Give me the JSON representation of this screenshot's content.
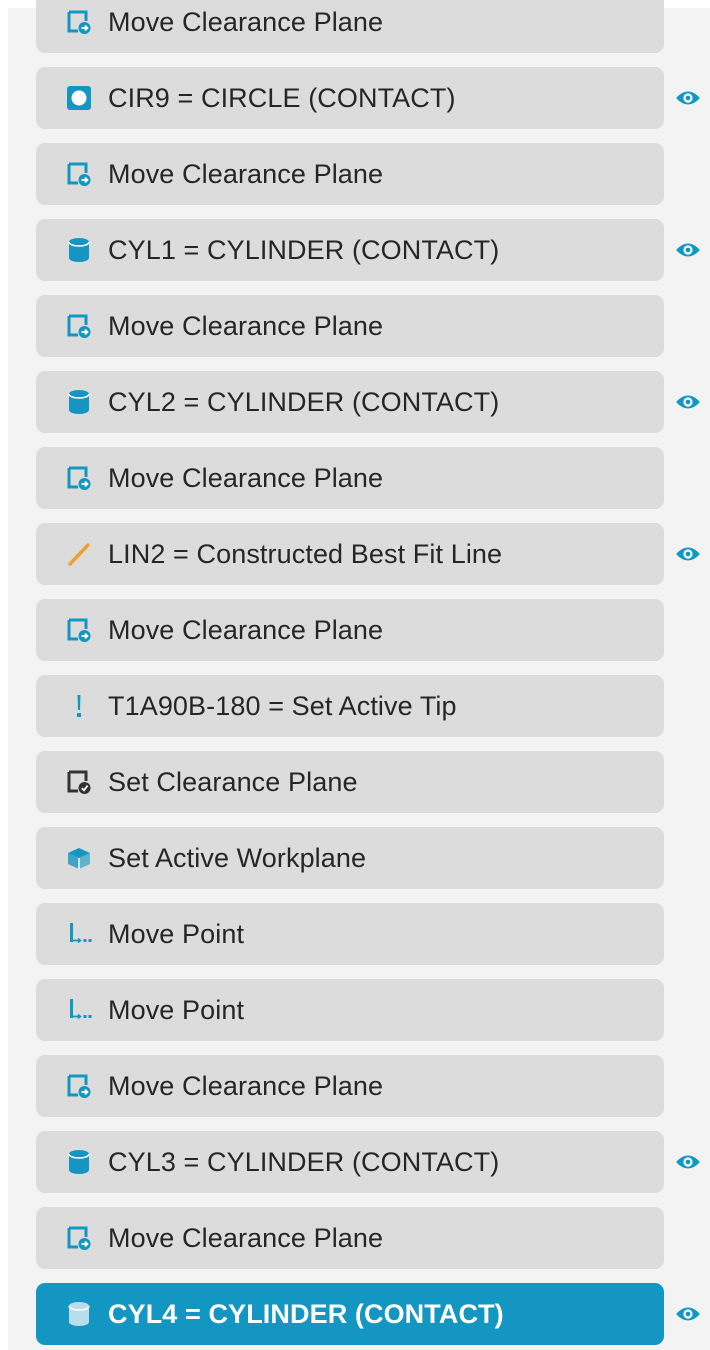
{
  "colors": {
    "panel_bg": "#f3f3f3",
    "row_bg": "#dcdcdc",
    "row_selected_bg": "#1396c2",
    "icon_blue": "#1396c2",
    "icon_orange": "#f0a030",
    "text": "#262626",
    "text_selected": "#ffffff"
  },
  "steps": [
    {
      "label": "Move Clearance Plane",
      "icon": "move-clearance-plane-icon",
      "visible": false,
      "selected": false
    },
    {
      "label": "CIR9 = CIRCLE (CONTACT)",
      "icon": "circle-icon",
      "visible": true,
      "selected": false
    },
    {
      "label": "Move Clearance Plane",
      "icon": "move-clearance-plane-icon",
      "visible": false,
      "selected": false
    },
    {
      "label": "CYL1 = CYLINDER (CONTACT)",
      "icon": "cylinder-icon",
      "visible": true,
      "selected": false
    },
    {
      "label": "Move Clearance Plane",
      "icon": "move-clearance-plane-icon",
      "visible": false,
      "selected": false
    },
    {
      "label": "CYL2 = CYLINDER (CONTACT)",
      "icon": "cylinder-icon",
      "visible": true,
      "selected": false
    },
    {
      "label": "Move Clearance Plane",
      "icon": "move-clearance-plane-icon",
      "visible": false,
      "selected": false
    },
    {
      "label": "LIN2 = Constructed Best Fit Line",
      "icon": "line-icon",
      "visible": true,
      "selected": false
    },
    {
      "label": "Move Clearance Plane",
      "icon": "move-clearance-plane-icon",
      "visible": false,
      "selected": false
    },
    {
      "label": "T1A90B-180 = Set Active Tip",
      "icon": "active-tip-icon",
      "visible": false,
      "selected": false
    },
    {
      "label": "Set Clearance Plane",
      "icon": "set-clearance-plane-icon",
      "visible": false,
      "selected": false
    },
    {
      "label": "Set Active Workplane",
      "icon": "workplane-icon",
      "visible": false,
      "selected": false
    },
    {
      "label": "Move Point",
      "icon": "move-point-icon",
      "visible": false,
      "selected": false
    },
    {
      "label": "Move Point",
      "icon": "move-point-icon",
      "visible": false,
      "selected": false
    },
    {
      "label": "Move Clearance Plane",
      "icon": "move-clearance-plane-icon",
      "visible": false,
      "selected": false
    },
    {
      "label": "CYL3 = CYLINDER (CONTACT)",
      "icon": "cylinder-icon",
      "visible": true,
      "selected": false
    },
    {
      "label": "Move Clearance Plane",
      "icon": "move-clearance-plane-icon",
      "visible": false,
      "selected": false
    },
    {
      "label": "CYL4 = CYLINDER (CONTACT)",
      "icon": "cylinder-icon",
      "visible": true,
      "selected": true
    }
  ],
  "eye_icon": "eye-icon"
}
